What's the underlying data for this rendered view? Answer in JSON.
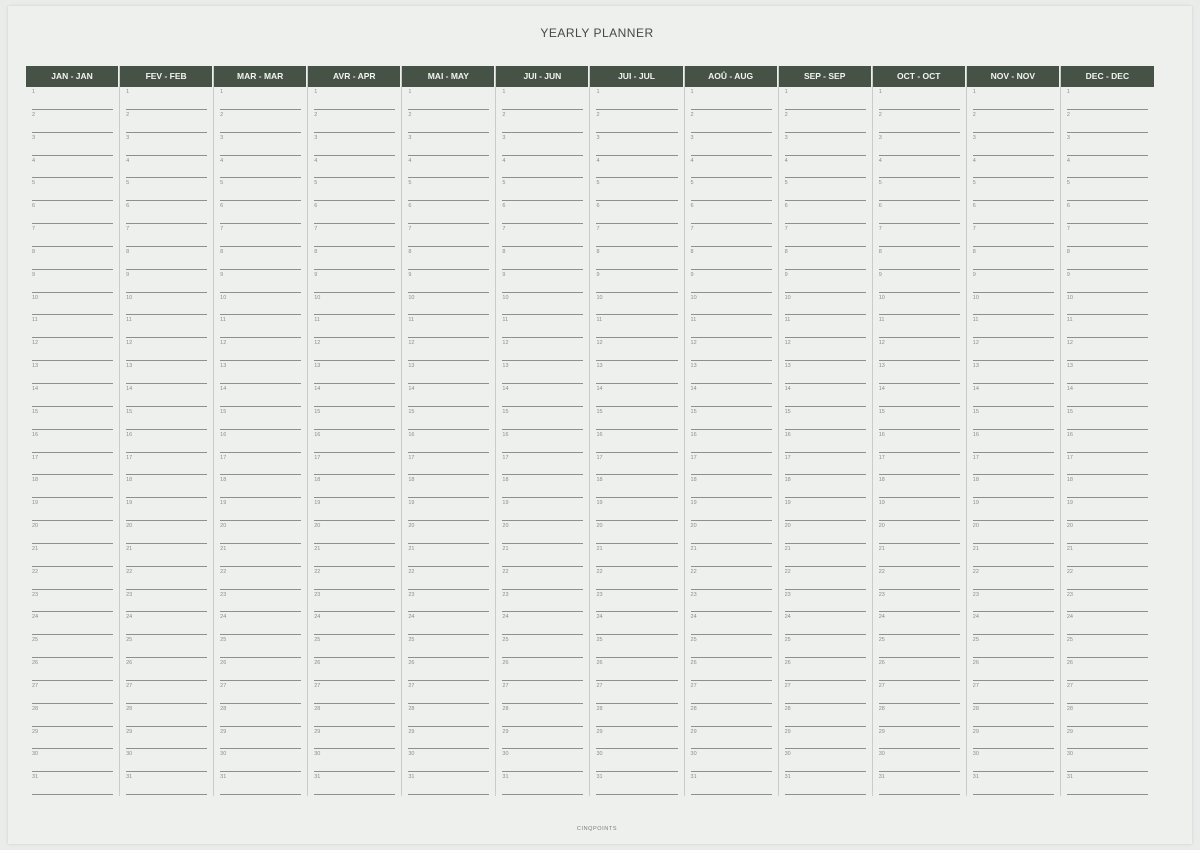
{
  "planner": {
    "title": "YEARLY PLANNER",
    "footer": "CINQPOINTS",
    "months": [
      "JAN - JAN",
      "FEV - FEB",
      "MAR - MAR",
      "AVR - APR",
      "MAI - MAY",
      "JUI - JUN",
      "JUI - JUL",
      "AOÛ - AUG",
      "SEP - SEP",
      "OCT - OCT",
      "NOV - NOV",
      "DEC - DEC"
    ],
    "days": [
      "1",
      "2",
      "3",
      "4",
      "5",
      "6",
      "7",
      "8",
      "9",
      "10",
      "11",
      "12",
      "13",
      "14",
      "15",
      "16",
      "17",
      "18",
      "19",
      "20",
      "21",
      "22",
      "23",
      "24",
      "25",
      "26",
      "27",
      "28",
      "29",
      "30",
      "31"
    ]
  },
  "colors": {
    "header_bg": "#465246",
    "paper": "#eef0ee",
    "rule": "#8d918d"
  }
}
